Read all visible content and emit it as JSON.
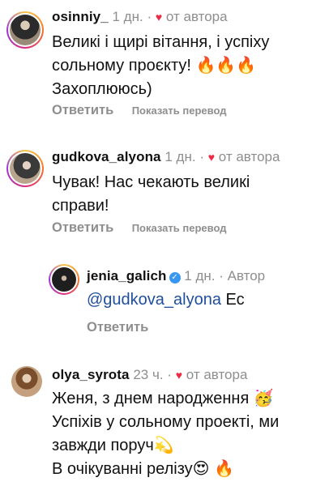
{
  "comments": [
    {
      "username": "osinniy_",
      "time": "1 дн.",
      "liked_by_author": "от автора",
      "lines": [
        "Великі і щирі вітання, і успіху",
        "сольному проєкту! 🔥🔥🔥",
        "Захоплююсь)"
      ],
      "reply_label": "Ответить",
      "translate_label": "Показать перевод"
    },
    {
      "username": "gudkova_alyona",
      "time": "1 дн.",
      "liked_by_author": "от автора",
      "lines": [
        "Чувак! Нас чекають великі",
        "справи!"
      ],
      "reply_label": "Ответить",
      "translate_label": "Показать перевод"
    },
    {
      "username": "jenia_galich",
      "time": "1 дн.",
      "author_label": "Автор",
      "mention": "@gudkova_alyona",
      "text_after_mention": " Ес",
      "reply_label": "Ответить"
    },
    {
      "username": "olya_syrota",
      "time": "23 ч.",
      "liked_by_author": "от автора",
      "lines": [
        "Женя, з днем народження 🥳",
        "Успіхів у сольному проекті, ми",
        "завжди поруч💫",
        "В очікуванні релізу😍 🔥"
      ]
    }
  ],
  "separator": "·",
  "icons": {
    "heart": "heart-icon",
    "verified": "verified-badge-icon"
  },
  "colors": {
    "heart": "#ed2a46",
    "mention": "#1f4f9b",
    "muted": "#8e8e8e",
    "verified": "#3897f0"
  }
}
